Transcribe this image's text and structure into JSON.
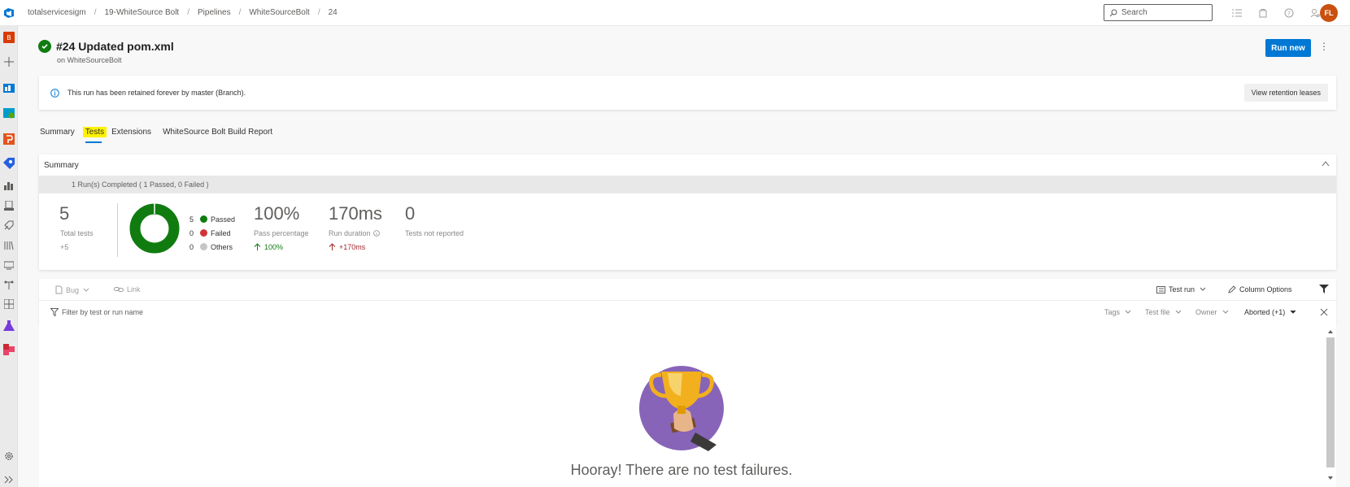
{
  "breadcrumb": {
    "items": [
      "totalservicesigm",
      "19-WhiteSource Bolt",
      "Pipelines",
      "WhiteSourceBolt",
      "24"
    ],
    "separator": "/"
  },
  "search": {
    "placeholder": "Search"
  },
  "user": {
    "initials": "FL"
  },
  "run": {
    "title": "#24 Updated pom.xml",
    "subtitle": "on WhiteSourceBolt",
    "run_new_label": "Run new"
  },
  "banner": {
    "text": "This run has been retained forever by master (Branch).",
    "button_label": "View retention leases"
  },
  "tabs": [
    {
      "label": "Summary"
    },
    {
      "label": "Tests"
    },
    {
      "label": "Extensions"
    },
    {
      "label": "WhiteSource Bolt Build Report"
    }
  ],
  "summary": {
    "title": "Summary",
    "runs_text": "1 Run(s) Completed ( 1 Passed, 0 Failed )",
    "total_tests": "5",
    "total_tests_label": "Total tests",
    "total_delta": "+5",
    "legend": [
      {
        "count": "5",
        "label": "Passed",
        "color": "#107c10"
      },
      {
        "count": "0",
        "label": "Failed",
        "color": "#d13438"
      },
      {
        "count": "0",
        "label": "Others",
        "color": "#c8c6c4"
      }
    ],
    "pass_percentage": "100%",
    "pass_percentage_label": "Pass percentage",
    "pass_delta": "100%",
    "run_duration": "170ms",
    "run_duration_label": "Run duration",
    "duration_delta": "+170ms",
    "not_reported": "0",
    "not_reported_label": "Tests not reported"
  },
  "toolbar": {
    "bug_label": "Bug",
    "link_label": "Link",
    "test_run_label": "Test run",
    "column_options_label": "Column Options",
    "filter_placeholder": "Filter by test or run name",
    "filters": [
      "Tags",
      "Test file",
      "Owner"
    ],
    "outcome_filter": "Aborted (+1)"
  },
  "results": {
    "empty_message": "Hooray! There are no test failures."
  },
  "colors": {
    "accent": "#0078d4",
    "success": "#107c10",
    "failure": "#d13438",
    "highlight": "#fff200"
  }
}
